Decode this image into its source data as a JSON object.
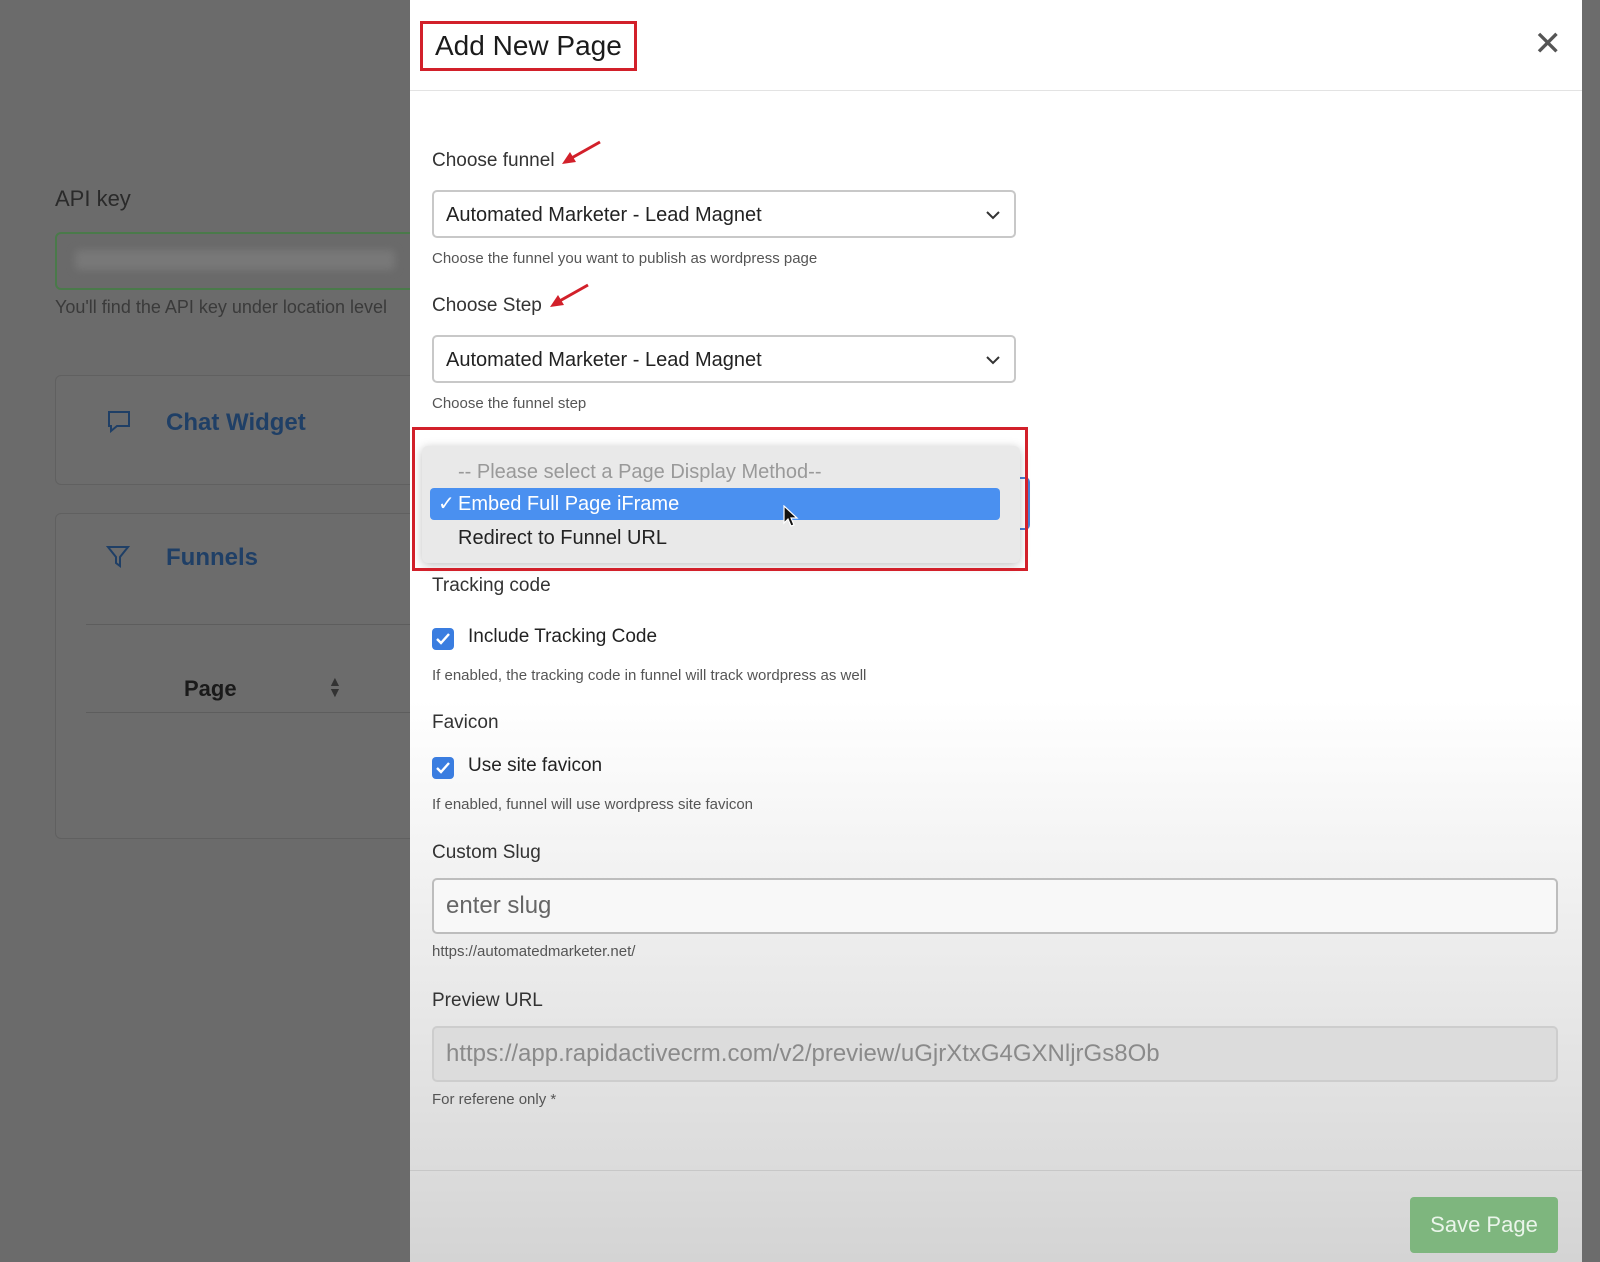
{
  "background": {
    "api_key_label": "API key",
    "api_key_help": "You'll find the API key under location level",
    "chat_widget_title": "Chat Widget",
    "funnels_title": "Funnels",
    "table_header_page": "Page"
  },
  "modal": {
    "title": "Add New Page",
    "close_icon": "close-icon",
    "choose_funnel": {
      "label": "Choose funnel",
      "value": "Automated Marketer - Lead Magnet",
      "help": "Choose the funnel you want to publish as wordpress page"
    },
    "choose_step": {
      "label": "Choose Step",
      "value": "Automated Marketer - Lead Magnet",
      "help": "Choose the funnel step"
    },
    "display_method": {
      "options": [
        "-- Please select a Page Display Method--",
        "Embed Full Page iFrame",
        "Redirect to Funnel URL"
      ],
      "selected": "Embed Full Page iFrame"
    },
    "tracking": {
      "label": "Tracking code",
      "checkbox_label": "Include Tracking Code",
      "checked": true,
      "help": "If enabled, the tracking code in funnel will track wordpress as well"
    },
    "favicon": {
      "label": "Favicon",
      "checkbox_label": "Use site favicon",
      "checked": true,
      "help": "If enabled, funnel will use wordpress site favicon"
    },
    "custom_slug": {
      "label": "Custom Slug",
      "placeholder": "enter slug",
      "help": "https://automatedmarketer.net/"
    },
    "preview_url": {
      "label": "Preview URL",
      "value": "https://app.rapidactivecrm.com/v2/preview/uGjrXtxG4GXNljrGs8Ob",
      "help": "For referene only *"
    },
    "save_button": "Save Page"
  },
  "colors": {
    "highlight_red": "#d2202a",
    "selected_blue": "#4a90f0",
    "checkbox_blue": "#3a7de0",
    "save_green": "#7eb67e"
  }
}
